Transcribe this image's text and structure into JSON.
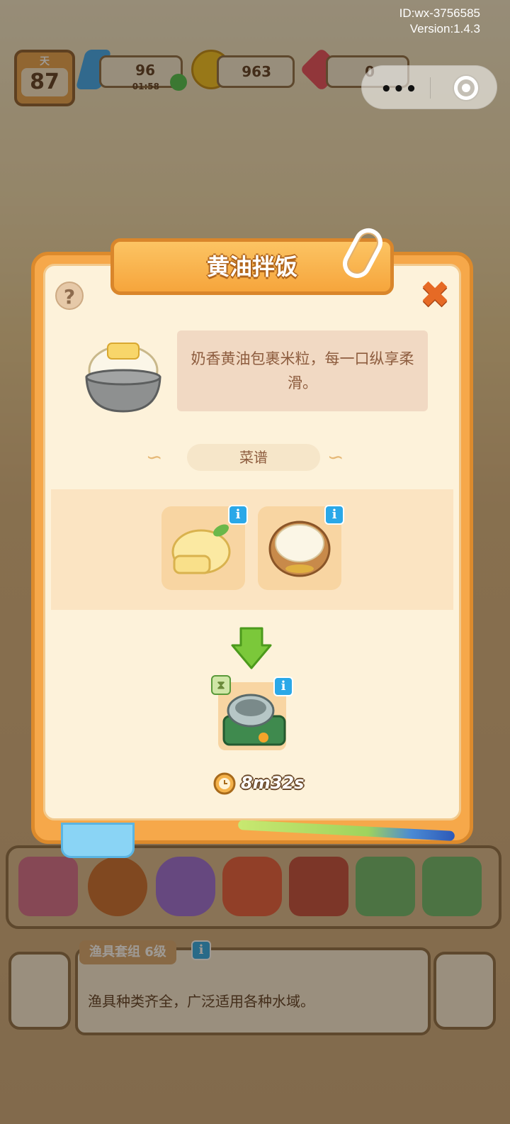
{
  "system": {
    "id_text": "ID:wx-3756585",
    "version_text": "Version:1.4.3",
    "menu_dots": "•••"
  },
  "hud": {
    "day_label": "天",
    "day_value": "87",
    "energy_value": "96",
    "energy_timer": "01:58",
    "coins_value": "963",
    "gems_value": "0"
  },
  "modal": {
    "title": "黄油拌饭",
    "help_symbol": "?",
    "close_symbol": "✖",
    "description": "奶香黄油包裹米粒，每一口纵享柔滑。",
    "recipe_label": "菜谱",
    "ingredients": [
      {
        "icon": "butter-icon",
        "info_symbol": "i"
      },
      {
        "icon": "rice-bowl-icon",
        "info_symbol": "i"
      }
    ],
    "machine": {
      "icon": "cooking-pot-machine-icon",
      "info_symbol": "i"
    },
    "cook_time": "8m32s"
  },
  "bottom_panel": {
    "tag": "渔具套组 6级",
    "tag_info_symbol": "i",
    "description": "渔具种类齐全，广泛适用各种水域。"
  },
  "colors": {
    "modal_orange": "#f6a84a",
    "modal_cream": "#fdf2da",
    "info_blue": "#2aa8e8",
    "arrow_green": "#7bc83a"
  }
}
